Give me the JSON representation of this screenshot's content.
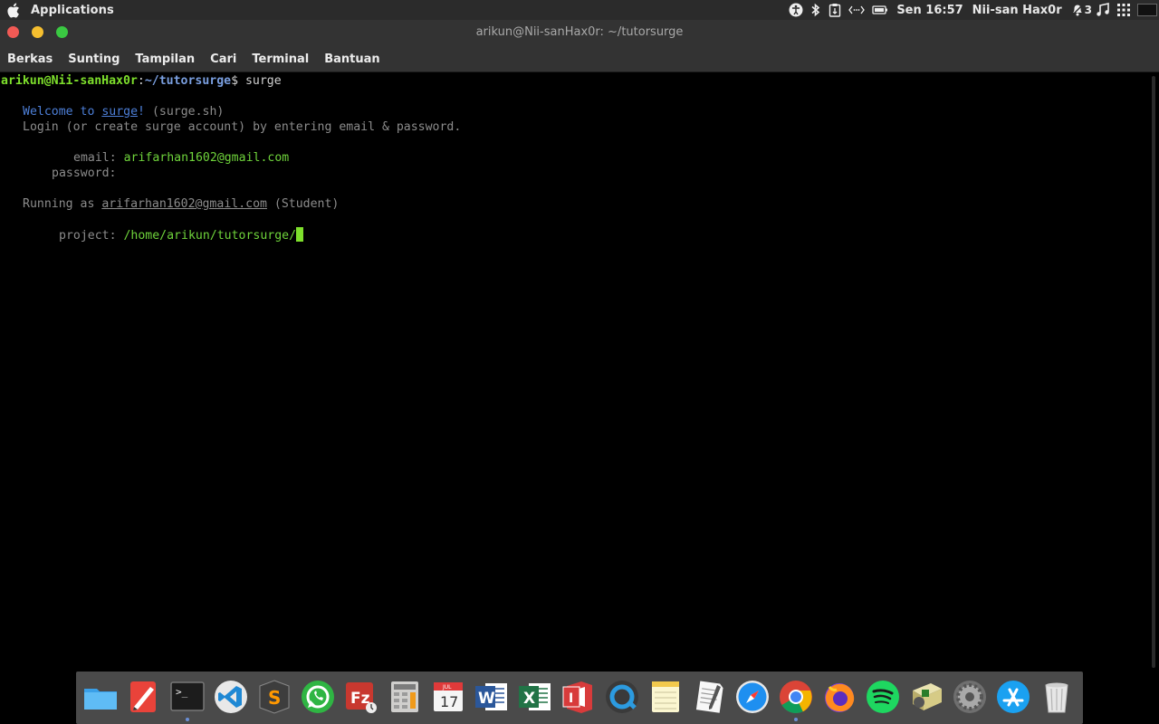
{
  "topbar": {
    "apple_icon": "apple-logo-icon",
    "applications_label": "Applications",
    "clock": "Sen 16:57",
    "user": "Nii-san Hax0r",
    "notification_count": "3",
    "tray_icons": [
      "accessibility-icon",
      "bluetooth-icon",
      "clipboard-icon",
      "network-icon",
      "battery-icon",
      "notifications-icon",
      "music-icon",
      "app-grid-icon",
      "workspace-icon"
    ]
  },
  "window": {
    "title": "arikun@Nii-sanHax0r: ~/tutorsurge",
    "buttons": [
      "close",
      "minimize",
      "maximize"
    ]
  },
  "menubar": {
    "items": [
      "Berkas",
      "Sunting",
      "Tampilan",
      "Cari",
      "Terminal",
      "Bantuan"
    ]
  },
  "terminal": {
    "prompt_user_host": "arikun@Nii-sanHax0r",
    "prompt_sep": ":",
    "prompt_path": "~/tutorsurge",
    "prompt_symbol": "$ ",
    "command": "surge",
    "welcome_prefix": "Welcome to ",
    "welcome_link": "surge",
    "welcome_bang": "!",
    "welcome_suffix": " (surge.sh)",
    "login_line": "Login (or create surge account) by entering email & password.",
    "email_label": "email:",
    "email_value": "arifarhan1602@gmail.com",
    "password_label": "password:",
    "running_prefix": "Running as ",
    "running_email": "arifarhan1602@gmail.com",
    "running_suffix": " (Student)",
    "project_label": "project:",
    "project_value": "/home/arikun/tutorsurge/"
  },
  "dock": {
    "apps": [
      {
        "name": "files-icon",
        "running": false
      },
      {
        "name": "sketchbook-icon",
        "running": false
      },
      {
        "name": "terminal-icon",
        "running": true
      },
      {
        "name": "vscode-icon",
        "running": false
      },
      {
        "name": "sublime-text-icon",
        "running": false
      },
      {
        "name": "whatsapp-icon",
        "running": false
      },
      {
        "name": "filezilla-icon",
        "running": false
      },
      {
        "name": "calculator-icon",
        "running": false
      },
      {
        "name": "calendar-icon",
        "running": false
      },
      {
        "name": "word-icon",
        "running": false
      },
      {
        "name": "excel-icon",
        "running": false
      },
      {
        "name": "office-icon",
        "running": false
      },
      {
        "name": "quicktime-icon",
        "running": false
      },
      {
        "name": "notes-icon",
        "running": false
      },
      {
        "name": "text-editor-icon",
        "running": false
      },
      {
        "name": "safari-icon",
        "running": false
      },
      {
        "name": "chrome-icon",
        "running": true
      },
      {
        "name": "firefox-icon",
        "running": false
      },
      {
        "name": "spotify-icon",
        "running": false
      },
      {
        "name": "archive-manager-icon",
        "running": false
      },
      {
        "name": "system-settings-icon",
        "running": false
      },
      {
        "name": "app-store-icon",
        "running": false
      },
      {
        "name": "trash-icon",
        "running": false
      }
    ],
    "calendar_month": "JUL",
    "calendar_day": "17"
  }
}
